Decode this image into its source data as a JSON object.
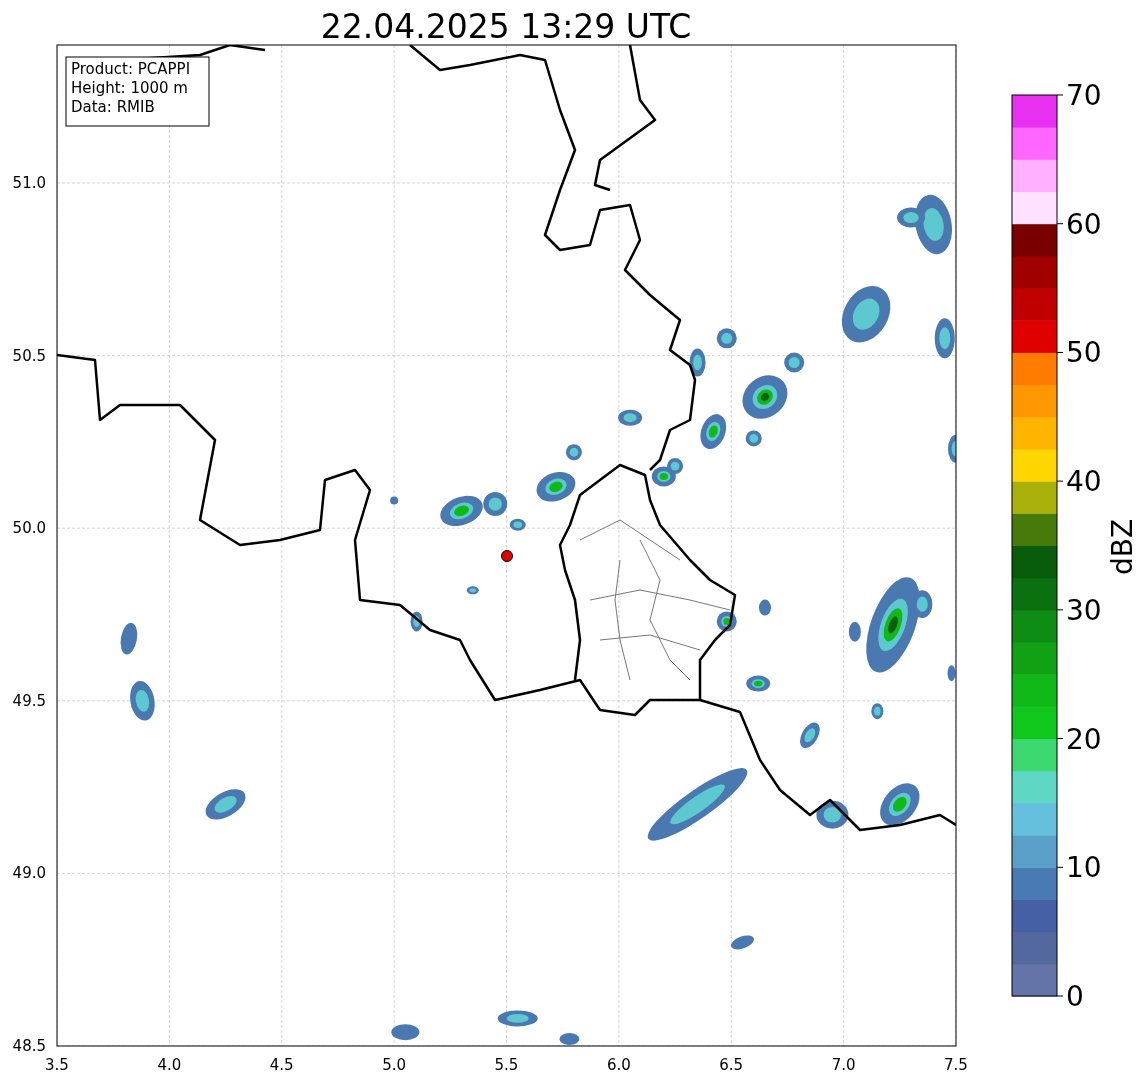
{
  "title": "22.04.2025 13:29 UTC",
  "info_box": [
    "Product: PCAPPI",
    "Height: 1000 m",
    "Data: RMIB"
  ],
  "x_axis": {
    "ticks": [
      "3.5",
      "4.0",
      "4.5",
      "5.0",
      "5.5",
      "6.0",
      "6.5",
      "7.0",
      "7.5"
    ]
  },
  "y_axis": {
    "ticks": [
      "51.0",
      "50.5",
      "50.0",
      "49.5",
      "49.0",
      "48.5"
    ]
  },
  "colorbar": {
    "label": "dBZ",
    "ticks": [
      "70",
      "60",
      "50",
      "40",
      "30",
      "20",
      "10",
      "0"
    ],
    "bands": [
      {
        "color": "#6574a8"
      },
      {
        "color": "#5468a0"
      },
      {
        "color": "#4560a4"
      },
      {
        "color": "#4a7ab4"
      },
      {
        "color": "#5aa0c8"
      },
      {
        "color": "#64c0dc"
      },
      {
        "color": "#5ed8c4"
      },
      {
        "color": "#3cd870"
      },
      {
        "color": "#10c81c"
      },
      {
        "color": "#10b818"
      },
      {
        "color": "#10a214"
      },
      {
        "color": "#0e8c14"
      },
      {
        "color": "#0a7010"
      },
      {
        "color": "#085c0c"
      },
      {
        "color": "#467a0a"
      },
      {
        "color": "#aab00a"
      },
      {
        "color": "#ffd600"
      },
      {
        "color": "#ffb400"
      },
      {
        "color": "#ff9800"
      },
      {
        "color": "#ff7c00"
      },
      {
        "color": "#e00000"
      },
      {
        "color": "#c00000"
      },
      {
        "color": "#a00000"
      },
      {
        "color": "#780000"
      },
      {
        "color": "#ffe0ff"
      },
      {
        "color": "#ffb0ff"
      },
      {
        "color": "#ff66ff"
      },
      {
        "color": "#e830f0"
      }
    ]
  }
}
